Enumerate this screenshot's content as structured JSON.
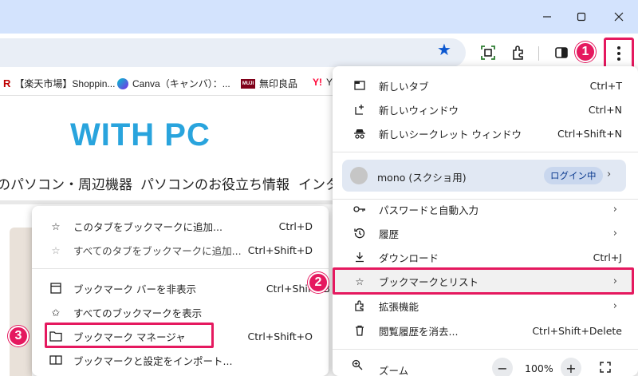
{
  "window": {
    "controls": {
      "minimize_icon": "minimize-icon",
      "maximize_icon": "maximize-icon",
      "close_icon": "close-icon"
    }
  },
  "toolbar": {
    "icons": [
      "bookmark-star-icon",
      "screenshot-icon",
      "extensions-icon",
      "side-panel-icon",
      "more-menu-icon"
    ],
    "accent_color": "#0b57d0"
  },
  "bookmarks_bar": {
    "items": [
      {
        "label": "【楽天市場】Shoppin...",
        "icon": "rakuten-icon"
      },
      {
        "label": "Canva（キャンバ）：...",
        "icon": "canva-icon"
      },
      {
        "label": "無印良品",
        "icon": "muji-icon",
        "icon_text": "MUJI"
      },
      {
        "label": "Y",
        "icon": "yahoo-icon"
      }
    ]
  },
  "page": {
    "logo": "WITH PC",
    "nav": [
      "のパソコン・周辺機器",
      "パソコンのお役立ち情報",
      "インタ"
    ],
    "logo_color": "#29a4dd"
  },
  "main_menu": {
    "items": [
      {
        "label": "新しいタブ",
        "shortcut": "Ctrl+T",
        "icon": "new-tab-icon"
      },
      {
        "label": "新しいウィンドウ",
        "shortcut": "Ctrl+N",
        "icon": "new-window-icon"
      },
      {
        "label": "新しいシークレット ウィンドウ",
        "shortcut": "Ctrl+Shift+N",
        "icon": "incognito-icon"
      }
    ],
    "profile": {
      "name": "mono (スクショ用)",
      "status": "ログイン中"
    },
    "items2": [
      {
        "label": "パスワードと自動入力",
        "icon": "key-icon",
        "submenu": true
      },
      {
        "label": "履歴",
        "icon": "history-icon",
        "submenu": true
      },
      {
        "label": "ダウンロード",
        "shortcut": "Ctrl+J",
        "icon": "download-icon"
      },
      {
        "label": "ブックマークとリスト",
        "icon": "star-outline-icon",
        "submenu": true
      },
      {
        "label": "拡張機能",
        "icon": "extensions-icon",
        "submenu": true
      },
      {
        "label": "閲覧履歴を消去...",
        "shortcut": "Ctrl+Shift+Delete",
        "icon": "trash-icon"
      }
    ],
    "zoom": {
      "label": "ズーム",
      "minus": "−",
      "value": "100%",
      "plus": "+"
    }
  },
  "bookmarks_submenu": {
    "items": [
      {
        "label": "このタブをブックマークに追加...",
        "shortcut": "Ctrl+D",
        "icon": "star-outline-icon"
      },
      {
        "label": "すべてのタブをブックマークに追加...",
        "shortcut": "Ctrl+Shift+D",
        "icon": "star-add-disabled-icon"
      },
      {
        "label": "ブックマーク バーを非表示",
        "shortcut": "Ctrl+Shift+B",
        "icon": "bookmark-bar-icon"
      },
      {
        "label": "すべてのブックマークを表示",
        "icon": "star-list-icon"
      },
      {
        "label": "ブックマーク マネージャ",
        "shortcut": "Ctrl+Shift+O",
        "icon": "bookmark-manager-icon"
      },
      {
        "label": "ブックマークと設定をインポート...",
        "icon": "import-icon"
      }
    ]
  },
  "annotations": {
    "badges": [
      "1",
      "2",
      "3"
    ],
    "highlight_color": "#e5195f"
  }
}
